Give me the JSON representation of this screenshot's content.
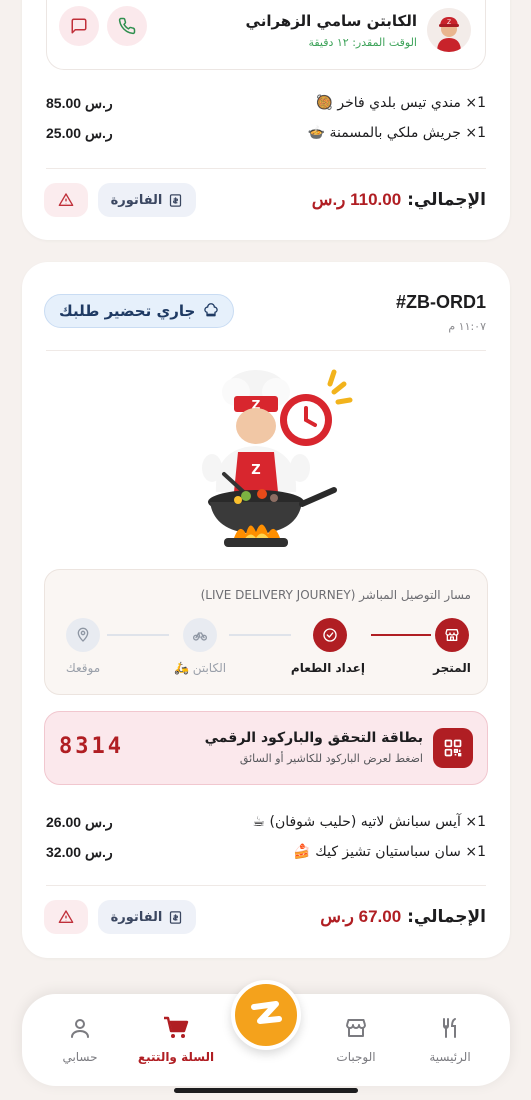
{
  "colors": {
    "brand_red": "#b01e23",
    "brand_orange": "#f4a21c",
    "eta_green": "#3ea35a",
    "page_bg": "#f6f1ee"
  },
  "order1": {
    "captain": {
      "name": "الكابتن سامي الزهراني",
      "eta": "الوقت المقدر: ١٢ دقيقة",
      "call_icon": "phone-icon",
      "chat_icon": "chat-icon"
    },
    "items": [
      {
        "name": "1× مندي تيس بلدي فاخر",
        "emoji": "🥘",
        "price": "85.00 ر.س"
      },
      {
        "name": "1× جريش ملكي بالمسمنة",
        "emoji": "🍲",
        "price": "25.00 ر.س"
      }
    ],
    "total_label": "الإجمالي:",
    "total_amount": "110.00 ر.س",
    "invoice_label": "الفاتورة"
  },
  "order2": {
    "id": "#ZB-ORD1",
    "time": "١١:٠٧ م",
    "status": "جاري تحضير طلبك",
    "journey": {
      "title": "مسار التوصيل المباشر (LIVE DELIVERY JOURNEY)",
      "steps": [
        {
          "label": "المتجر",
          "icon": "store-icon",
          "active": true
        },
        {
          "label": "إعداد الطعام",
          "icon": "check-icon",
          "active": true
        },
        {
          "label": "الكابتن 🛵",
          "icon": "bike-icon",
          "active": false
        },
        {
          "label": "موقعك",
          "icon": "location-pin-icon",
          "active": false
        }
      ]
    },
    "qr": {
      "title": "بطاقة التحقق والباركود الرقمي",
      "subtitle": "اضغط لعرض الباركود للكاشير أو السائق",
      "code": "8314"
    },
    "items": [
      {
        "name": "1× آيس سبانش لاتيه (حليب شوفان)",
        "emoji": "☕",
        "price": "26.00 ر.س"
      },
      {
        "name": "1× سان سباستيان تشيز كيك",
        "emoji": "🍰",
        "price": "32.00 ر.س"
      }
    ],
    "total_label": "الإجمالي:",
    "total_amount": "67.00 ر.س",
    "invoice_label": "الفاتورة"
  },
  "nav": {
    "items": [
      {
        "label": "الرئيسية",
        "icon": "utensils-icon",
        "active": false
      },
      {
        "label": "الوجبات",
        "icon": "store-icon",
        "active": false
      },
      {
        "label": "السلة والتتبع",
        "icon": "cart-icon",
        "active": true
      },
      {
        "label": "حسابي",
        "icon": "user-icon",
        "active": false
      }
    ],
    "center_icon": "z-logo-icon"
  }
}
